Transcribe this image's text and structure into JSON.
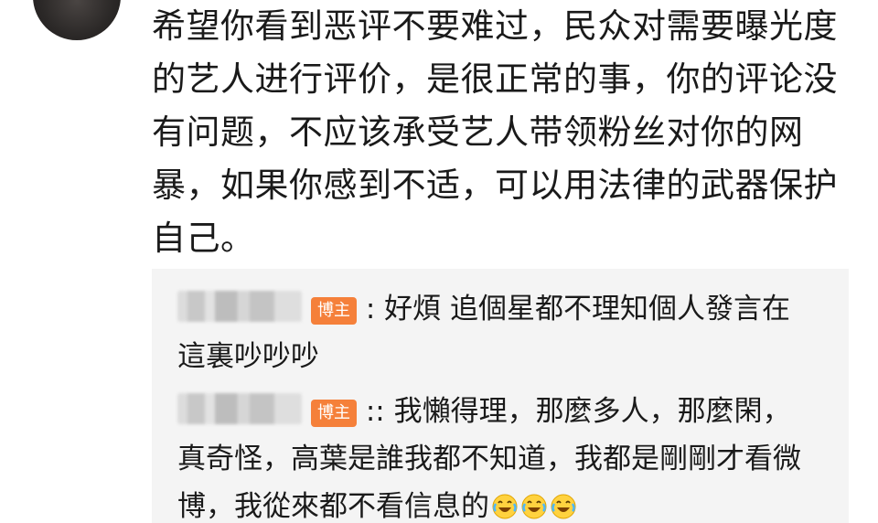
{
  "main_comment": {
    "text": "希望你看到恶评不要难过，民众对需要曝光度的艺人进行评价，是很正常的事，你的评论没有问题，不应该承受艺人带领粉丝对你的网暴，如果你感到不适，可以用法律的武器保护自己。"
  },
  "replies": [
    {
      "badge": "博主",
      "text": ": 好煩 追個星都不理知個人發言在這裏吵吵吵"
    },
    {
      "badge": "博主",
      "text": ":: 我懶得理，那麼多人，那麼閑，真奇怪，高葉是誰我都不知道，我都是剛剛才看微博，我從來都不看信息的",
      "emoji": [
        "laugh-cry-icon",
        "laugh-cry-icon",
        "laugh-cry-icon"
      ]
    }
  ],
  "colors": {
    "badge": "#f5803a",
    "reply_background": "#f4f4f4",
    "text": "#1a1a1a"
  }
}
